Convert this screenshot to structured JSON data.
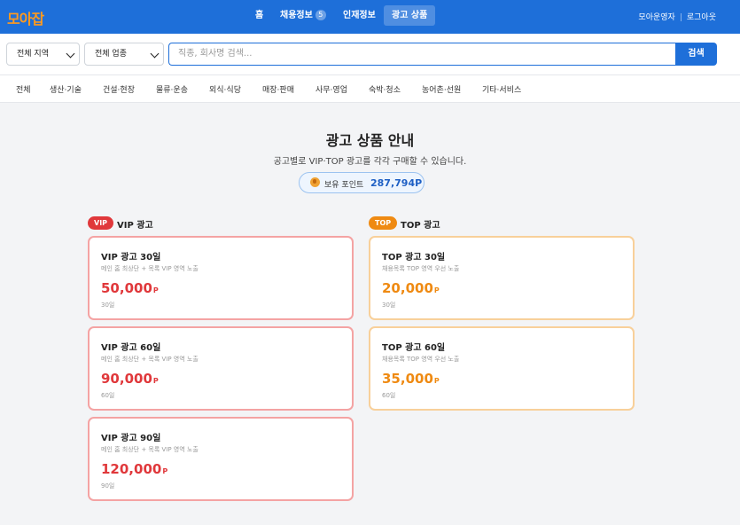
{
  "header": {
    "logo": "모아잡",
    "nav": [
      {
        "label": "홈",
        "badge": null
      },
      {
        "label": "채용정보",
        "badge": "5"
      },
      {
        "label": "인재정보",
        "badge": null
      },
      {
        "label": "광고 상품",
        "badge": null
      }
    ],
    "user": "모아운영자",
    "logout": "로그아웃"
  },
  "search": {
    "region": "전체 지역",
    "industry": "전체 업종",
    "placeholder": "직종, 회사명 검색...",
    "button": "검색"
  },
  "categories": [
    "전체",
    "생산·기술",
    "건설·현장",
    "물류·운송",
    "외식·식당",
    "매장·판매",
    "사무·영업",
    "숙박·청소",
    "농어촌·선원",
    "기타·서비스"
  ],
  "main": {
    "title": "광고 상품 안내",
    "subtitle": "공고별로 VIP·TOP 광고를 각각 구매할 수 있습니다.",
    "points_label": "보유 포인트",
    "points_value": "287,794P"
  },
  "vip": {
    "badge": "VIP",
    "title": "VIP 광고",
    "items": [
      {
        "name": "VIP 광고 30일",
        "desc": "메인 홈 최상단 + 목록 VIP 영역 노출",
        "price": "50,000",
        "unit": "P",
        "days": "30일"
      },
      {
        "name": "VIP 광고 60일",
        "desc": "메인 홈 최상단 + 목록 VIP 영역 노출",
        "price": "90,000",
        "unit": "P",
        "days": "60일"
      },
      {
        "name": "VIP 광고 90일",
        "desc": "메인 홈 최상단 + 목록 VIP 영역 노출",
        "price": "120,000",
        "unit": "P",
        "days": "90일"
      }
    ]
  },
  "top": {
    "badge": "TOP",
    "title": "TOP 광고",
    "items": [
      {
        "name": "TOP 광고 30일",
        "desc": "채용목록 TOP 영역 우선 노출",
        "price": "20,000",
        "unit": "P",
        "days": "30일"
      },
      {
        "name": "TOP 광고 60일",
        "desc": "채용목록 TOP 영역 우선 노출",
        "price": "35,000",
        "unit": "P",
        "days": "60일"
      }
    ]
  },
  "colors": {
    "primary": "#1e6fd9",
    "logo": "#ff9a1f",
    "vip": "#e0383b",
    "top": "#ef8a12"
  }
}
